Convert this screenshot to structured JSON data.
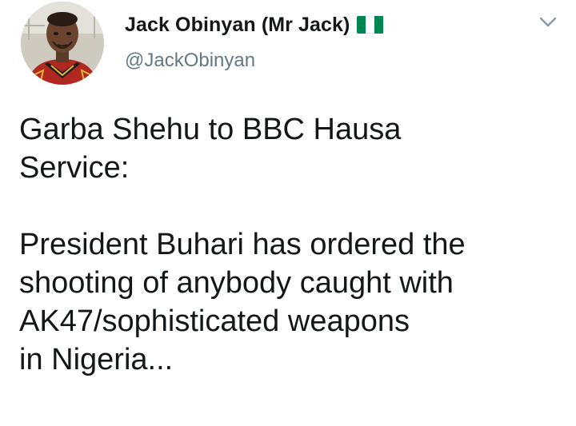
{
  "tweet": {
    "author": {
      "display_name": "Jack Obinyan (Mr Jack)",
      "handle": "@JackObinyan",
      "avatar": "profile-photo",
      "flag_icon": "nigeria-flag-icon"
    },
    "menu_icon": "chevron-down-icon",
    "text": "Garba Shehu to BBC Hausa\nService:\n\nPresident Buhari has ordered the\nshooting of anybody caught with\nAK47/sophisticated weapons\nin Nigeria..."
  },
  "colors": {
    "text_primary": "#14171a",
    "text_secondary": "#657786",
    "flag_green": "#008751",
    "flag_white": "#ffffff"
  }
}
